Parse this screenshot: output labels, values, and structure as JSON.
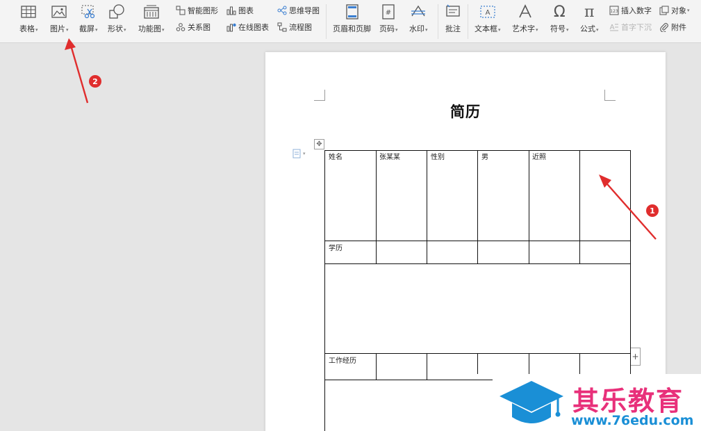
{
  "toolbar": {
    "table": "表格",
    "picture": "图片",
    "screenshot": "截屏",
    "shape": "形状",
    "function_chart": "功能图",
    "smart_graphic": "智能图形",
    "chart": "图表",
    "mind_map": "思维导图",
    "relation_chart": "关系图",
    "online_chart": "在线图表",
    "flowchart": "流程图",
    "header_footer": "页眉和页脚",
    "page_number": "页码",
    "watermark": "水印",
    "comment": "批注",
    "text_box": "文本框",
    "word_art": "艺术字",
    "symbol": "符号",
    "formula": "公式",
    "insert_number": "插入数字",
    "object": "对象",
    "drop_cap": "首字下沉",
    "attachment": "附件"
  },
  "document": {
    "title": "简历",
    "table": {
      "row1": [
        "姓名",
        "张某某",
        "性别",
        "男",
        "近照",
        ""
      ],
      "education_label": "学历",
      "work_label": "工作经历"
    }
  },
  "annotations": {
    "badge1": "1",
    "badge2": "2",
    "arrow_color": "#e02d2d"
  },
  "watermark": {
    "name": "其乐教育",
    "url": "www.76edu.com",
    "name_color": "#e8307a",
    "url_color": "#1a8fd6"
  }
}
